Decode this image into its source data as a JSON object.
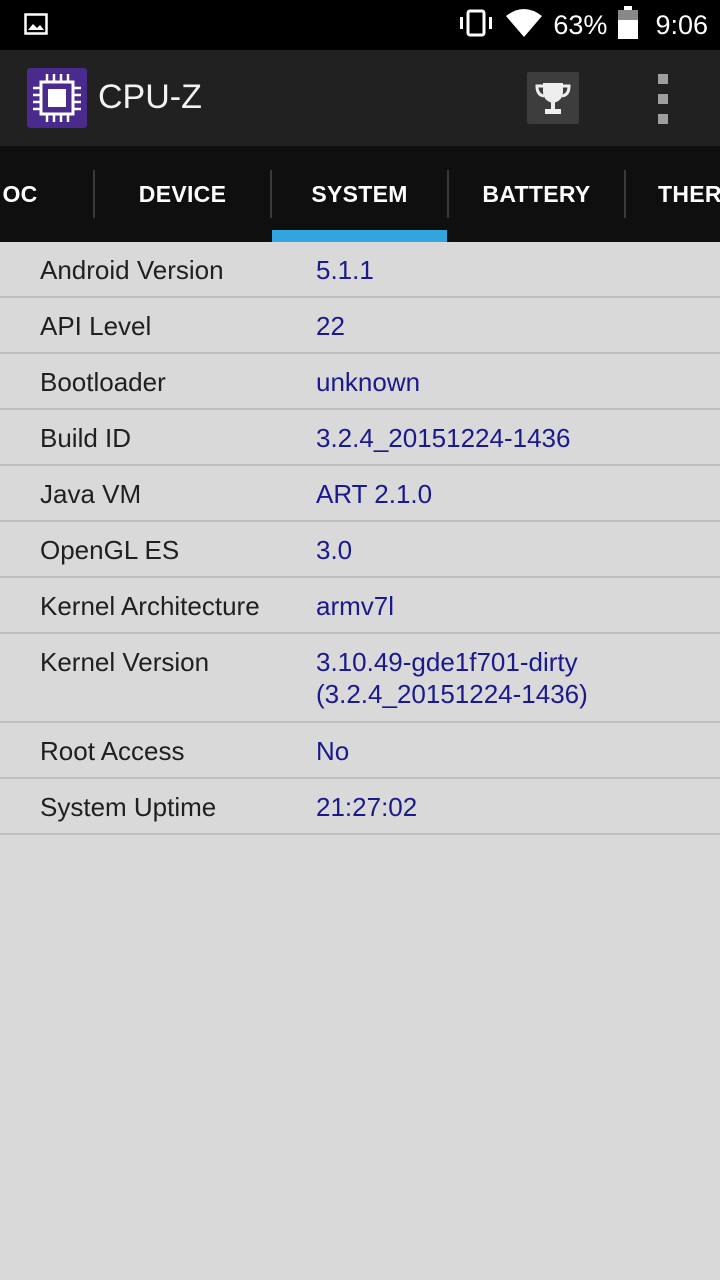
{
  "status_bar": {
    "battery_percent": "63%",
    "time": "9:06",
    "icons": [
      "image-icon",
      "vibrate-icon",
      "wifi-icon",
      "battery-icon"
    ]
  },
  "app_bar": {
    "title": "CPU-Z",
    "icons": [
      "cpu-logo-icon",
      "trophy-icon",
      "overflow-menu-icon"
    ]
  },
  "tabs": [
    {
      "label": "OC"
    },
    {
      "label": "DEVICE"
    },
    {
      "label": "SYSTEM"
    },
    {
      "label": "BATTERY"
    },
    {
      "label": "THER"
    }
  ],
  "active_tab": "SYSTEM",
  "accent_color": "#33a4dd",
  "value_color": "#1a1a8c",
  "rows": [
    {
      "label": "Android Version",
      "value": "5.1.1"
    },
    {
      "label": "API Level",
      "value": "22"
    },
    {
      "label": "Bootloader",
      "value": "unknown"
    },
    {
      "label": "Build ID",
      "value": "3.2.4_20151224-1436"
    },
    {
      "label": "Java VM",
      "value": "ART 2.1.0"
    },
    {
      "label": "OpenGL ES",
      "value": "3.0"
    },
    {
      "label": "Kernel Architecture",
      "value": "armv7l"
    },
    {
      "label": "Kernel Version",
      "value": "3.10.49-gde1f701-dirty",
      "value_line2": "(3.2.4_20151224-1436)"
    },
    {
      "label": "Root Access",
      "value": "No"
    },
    {
      "label": "System Uptime",
      "value": "21:27:02"
    }
  ]
}
